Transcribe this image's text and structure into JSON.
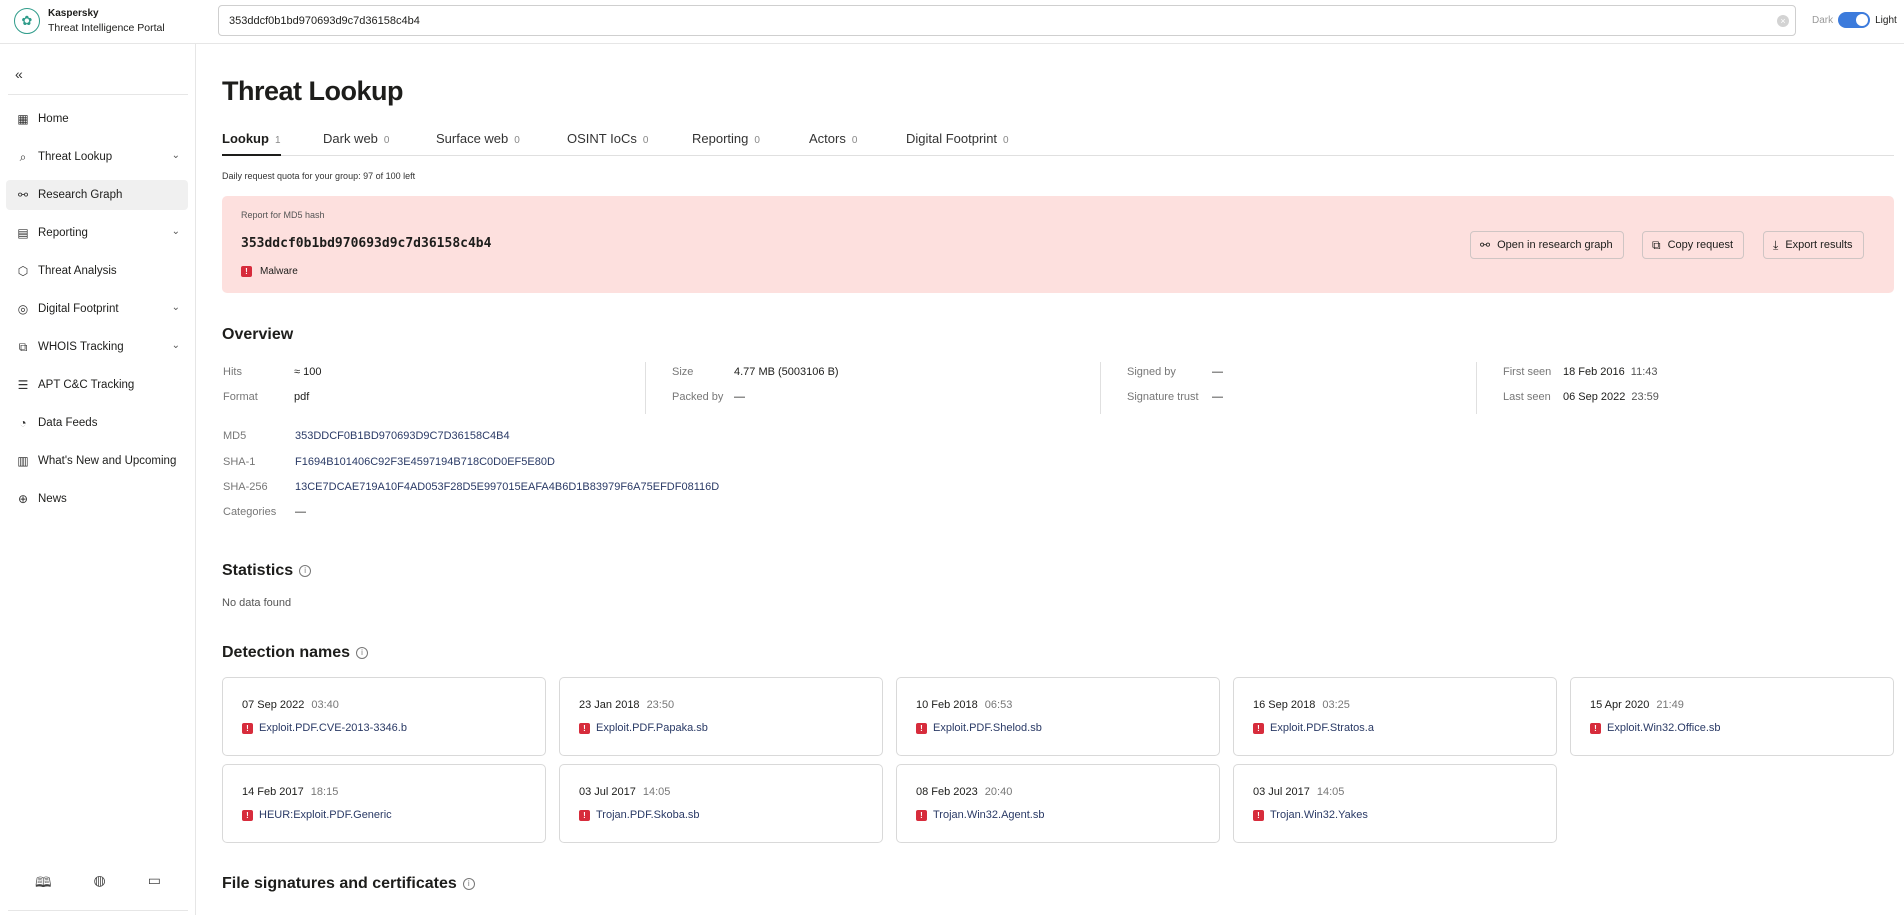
{
  "app": {
    "brand_line1": "Kaspersky",
    "brand_line2": "Threat Intelligence Portal"
  },
  "search": {
    "value": "353ddcf0b1bd970693d9c7d36158c4b4"
  },
  "theme": {
    "dark_label": "Dark",
    "light_label": "Light",
    "is_light": true
  },
  "sidebar": {
    "items": [
      {
        "label": "Home",
        "icon": "dashboard-icon"
      },
      {
        "label": "Threat Lookup",
        "icon": "search-icon",
        "expandable": true
      },
      {
        "label": "Research Graph",
        "icon": "graph-icon",
        "active": true
      },
      {
        "label": "Reporting",
        "icon": "report-icon",
        "expandable": true
      },
      {
        "label": "Threat Analysis",
        "icon": "cube-icon"
      },
      {
        "label": "Digital Footprint",
        "icon": "fingerprint-icon",
        "expandable": true
      },
      {
        "label": "WHOIS Tracking",
        "icon": "whois-icon",
        "expandable": true
      },
      {
        "label": "APT C&C Tracking",
        "icon": "server-icon"
      },
      {
        "label": "Data Feeds",
        "icon": "feed-icon"
      },
      {
        "label": "What's New and Upcoming",
        "icon": "news-list-icon"
      },
      {
        "label": "News",
        "icon": "globe-icon"
      }
    ],
    "bottom_icons": [
      "book-icon",
      "support-icon",
      "chat-icon"
    ]
  },
  "page": {
    "title": "Threat Lookup",
    "quota": "Daily request quota for your group: 97 of 100 left"
  },
  "tabs": [
    {
      "label": "Lookup",
      "count": "1",
      "active": true
    },
    {
      "label": "Dark web",
      "count": "0"
    },
    {
      "label": "Surface web",
      "count": "0"
    },
    {
      "label": "OSINT IoCs",
      "count": "0"
    },
    {
      "label": "Reporting",
      "count": "0"
    },
    {
      "label": "Actors",
      "count": "0"
    },
    {
      "label": "Digital Footprint",
      "count": "0"
    }
  ],
  "report": {
    "label": "Report for MD5 hash",
    "hash": "353ddcf0b1bd970693d9c7d36158c4b4",
    "verdict": "Malware",
    "buttons": {
      "open_graph": "Open in research graph",
      "copy": "Copy request",
      "export": "Export results"
    }
  },
  "overview": {
    "title": "Overview",
    "hits_label": "Hits",
    "hits": "≈ 100",
    "format_label": "Format",
    "format": "pdf",
    "size_label": "Size",
    "size": "4.77 MB (5003106 B)",
    "packed_label": "Packed by",
    "packed": "—",
    "signed_label": "Signed by",
    "signed": "—",
    "trust_label": "Signature trust",
    "trust": "—",
    "first_seen_label": "First seen",
    "first_seen_date": "18 Feb 2016",
    "first_seen_time": "11:43",
    "last_seen_label": "Last seen",
    "last_seen_date": "06 Sep 2022",
    "last_seen_time": "23:59",
    "md5_label": "MD5",
    "md5": "353DDCF0B1BD970693D9C7D36158C4B4",
    "sha1_label": "SHA-1",
    "sha1": "F1694B101406C92F3E4597194B718C0D0EF5E80D",
    "sha256_label": "SHA-256",
    "sha256": "13CE7DCAE719A10F4AD053F28D5E997015EAFA4B6D1B83979F6A75EFDF08116D",
    "categories_label": "Categories",
    "categories": "—"
  },
  "statistics": {
    "title": "Statistics",
    "empty": "No data found"
  },
  "detections": {
    "title": "Detection names",
    "items": [
      {
        "date": "07 Sep 2022",
        "time": "03:40",
        "name": "Exploit.PDF.CVE-2013-3346.b"
      },
      {
        "date": "23 Jan 2018",
        "time": "23:50",
        "name": "Exploit.PDF.Papaka.sb"
      },
      {
        "date": "10 Feb 2018",
        "time": "06:53",
        "name": "Exploit.PDF.Shelod.sb"
      },
      {
        "date": "16 Sep 2018",
        "time": "03:25",
        "name": "Exploit.PDF.Stratos.a"
      },
      {
        "date": "15 Apr 2020",
        "time": "21:49",
        "name": "Exploit.Win32.Office.sb"
      },
      {
        "date": "14 Feb 2017",
        "time": "18:15",
        "name": "HEUR:Exploit.PDF.Generic"
      },
      {
        "date": "03 Jul 2017",
        "time": "14:05",
        "name": "Trojan.PDF.Skoba.sb"
      },
      {
        "date": "08 Feb 2023",
        "time": "20:40",
        "name": "Trojan.Win32.Agent.sb"
      },
      {
        "date": "03 Jul 2017",
        "time": "14:05",
        "name": "Trojan.Win32.Yakes"
      }
    ]
  },
  "signatures": {
    "title": "File signatures and certificates"
  },
  "colors": {
    "accent_blue": "#3c7bdc",
    "report_bg": "#fde0de",
    "malware_red": "#d72c3c",
    "link_navy": "#2a3a66"
  }
}
